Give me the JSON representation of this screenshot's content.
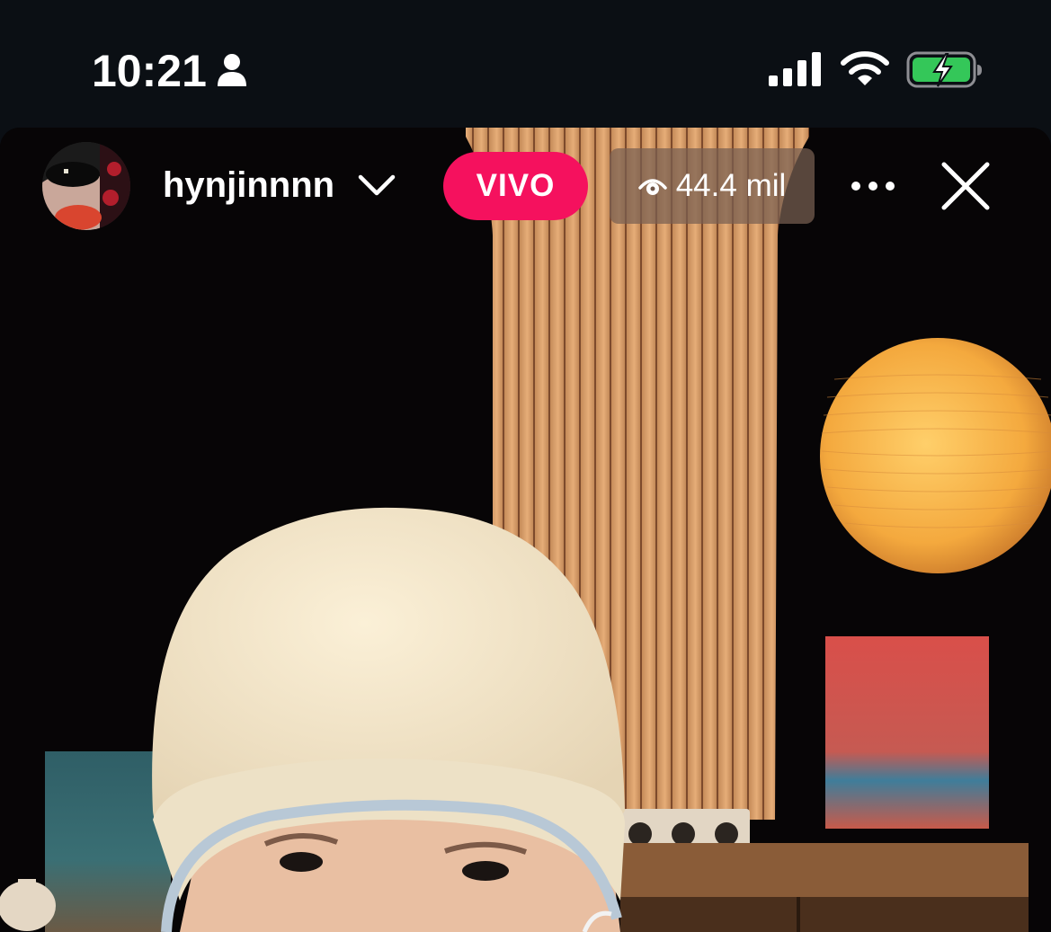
{
  "status_bar": {
    "time": "10:21",
    "icons": [
      "person-icon",
      "cellular-signal-icon",
      "wifi-icon",
      "battery-charging-icon"
    ],
    "battery_color": "#34c759"
  },
  "live_header": {
    "username": "hynjinnnn",
    "live_label": "VIVO",
    "live_color": "#f5115e",
    "viewer_count": "44.4 mil",
    "icons": [
      "avatar",
      "chevron-down-icon",
      "eye-icon",
      "more-icon",
      "close-icon"
    ]
  }
}
